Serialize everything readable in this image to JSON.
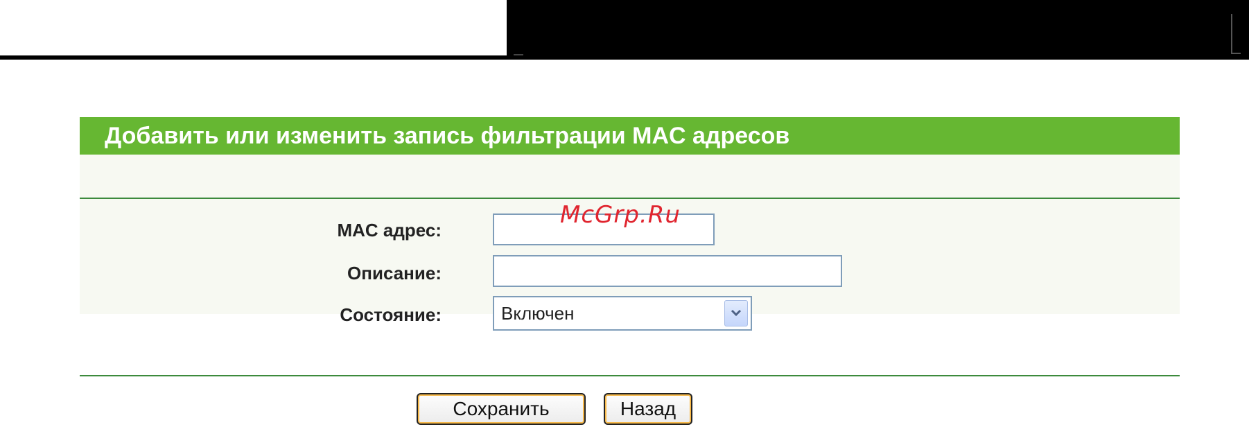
{
  "header": {
    "title": "Добавить или изменить запись фильтрации MAC адресов"
  },
  "form": {
    "mac": {
      "label": "MAC адрес:",
      "value": ""
    },
    "description": {
      "label": "Описание:",
      "value": ""
    },
    "status": {
      "label": "Состояние:",
      "selected": "Включен"
    }
  },
  "buttons": {
    "save": "Сохранить",
    "back": "Назад"
  },
  "watermark": "McGrp.Ru",
  "colors": {
    "header_bg": "#66b732",
    "rule": "#3c8a3c",
    "band_bg": "#f7f9f2"
  },
  "icons": {
    "select_arrow": "chevron-down-icon"
  }
}
